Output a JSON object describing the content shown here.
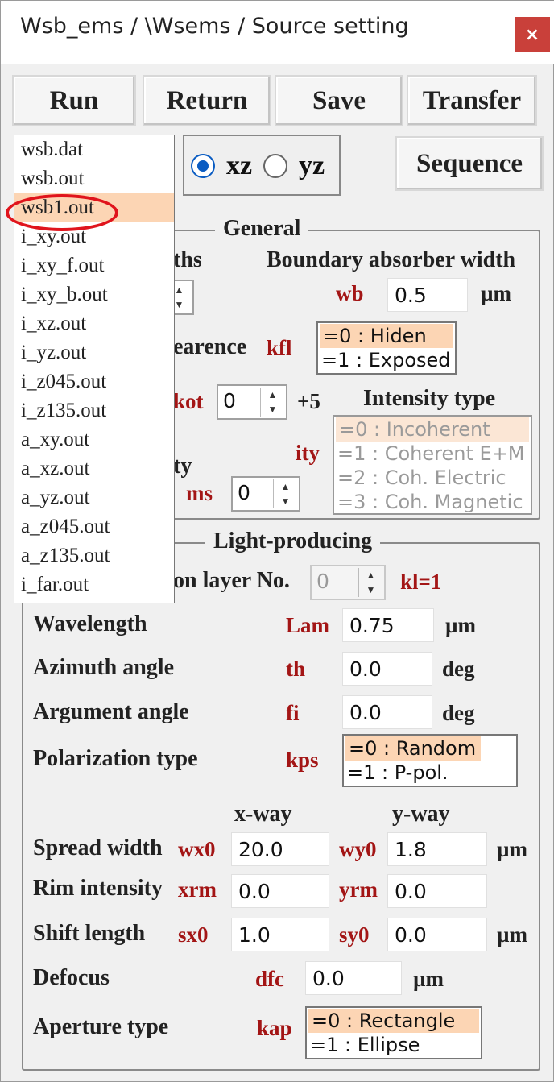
{
  "window": {
    "title": "Wsb_ems / \\Wsems / Source setting",
    "close_glyph": "×"
  },
  "toolbar": {
    "run": "Run",
    "return": "Return",
    "save": "Save",
    "transfer": "Transfer",
    "sequence": "Sequence"
  },
  "plane": {
    "options": [
      "xz",
      "yz"
    ],
    "selected": "xz"
  },
  "file_list": {
    "items": [
      "wsb.dat",
      "wsb.out",
      "wsb1.out",
      "i_xy.out",
      "i_xy_f.out",
      "i_xy_b.out",
      "i_xz.out",
      "i_yz.out",
      "i_z045.out",
      "i_z135.out",
      "a_xy.out",
      "a_xz.out",
      "a_yz.out",
      "a_z045.out",
      "a_z135.out",
      "i_far.out"
    ],
    "highlighted": "wsb1.out"
  },
  "general": {
    "title": "General",
    "partial_labels": {
      "widths": "ths",
      "appearance": "earence",
      "intensity": "ty"
    },
    "boundary_label": "Boundary absorber width",
    "wb": {
      "var": "wb",
      "value": "0.5",
      "unit": "µm"
    },
    "kfl": {
      "var": "kfl",
      "options": [
        "=0 : Hiden",
        "=1 : Exposed"
      ],
      "selected": 0
    },
    "kot": {
      "var": "kot",
      "value": "0",
      "suffix": "+5"
    },
    "intensity_type": {
      "label": "Intensity type",
      "var": "ity",
      "options": [
        "=0 : Incoherent",
        "=1 : Coherent E+M",
        "=2 : Coh. Electric",
        "=3 : Coh. Magnetic"
      ],
      "selected": 0
    },
    "ms": {
      "var": "ms",
      "value": "0"
    }
  },
  "light": {
    "title": "Light-producing",
    "layer_label": "on layer No.",
    "layer_value": "0",
    "kl_note": "kl=1",
    "wavelength": {
      "label": "Wavelength",
      "var": "Lam",
      "value": "0.75",
      "unit": "µm"
    },
    "azimuth": {
      "label": "Azimuth angle",
      "var": "th",
      "value": "0.0",
      "unit": "deg"
    },
    "argument": {
      "label": "Argument angle",
      "var": "fi",
      "value": "0.0",
      "unit": "deg"
    },
    "polarization": {
      "label": "Polarization type",
      "var": "kps",
      "options": [
        "=0 : Random",
        "=1 : P-pol."
      ],
      "selected": 0
    },
    "x_way": "x-way",
    "y_way": "y-way",
    "spread": {
      "label": "Spread width",
      "xvar": "wx0",
      "xval": "20.0",
      "yvar": "wy0",
      "yval": "1.8",
      "unit": "µm"
    },
    "rim": {
      "label": "Rim intensity",
      "xvar": "xrm",
      "xval": "0.0",
      "yvar": "yrm",
      "yval": "0.0"
    },
    "shift": {
      "label": "Shift length",
      "xvar": "sx0",
      "xval": "1.0",
      "yvar": "sy0",
      "yval": "0.0",
      "unit": "µm"
    },
    "defocus": {
      "label": "Defocus",
      "var": "dfc",
      "value": "0.0",
      "unit": "µm"
    },
    "aperture": {
      "label": "Aperture type",
      "var": "kap",
      "options": [
        "=0 : Rectangle",
        "=1 : Ellipse"
      ],
      "selected": 0
    }
  },
  "colors": {
    "var_red": "#a31515",
    "selection": "#fcd5b4",
    "radio_blue": "#0a5cc2",
    "close_red": "#c9403a",
    "annotation_ring": "#e0141c"
  }
}
